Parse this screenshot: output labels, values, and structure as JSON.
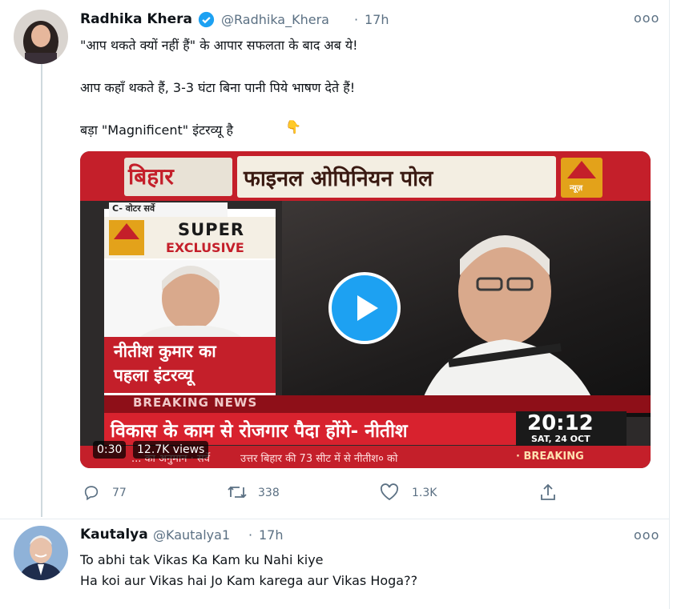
{
  "tweet": {
    "author_name": "Radhika Khera",
    "handle": "@Radhika_Khera",
    "time": "17h",
    "more": "ooo",
    "lines": [
      "\"आप थकते क्यों नहीं हैं\" के आपार सफलता के बाद अब ये!",
      "आप कहाँ थकते हैं, 3-3 घंटा बिना पानी पिये भाषण देते हैं!",
      "बड़ा \"Magnificent\" इंटरव्यू है"
    ],
    "emoji": "👇",
    "video": {
      "duration": "0:30",
      "views": "12.7K views",
      "frame_text": {
        "bihar": "बिहार",
        "title": "फाइनल ओपिनियन पोल",
        "abp_small": "न्यूज़",
        "cvoter": "C- वोटर सर्वे",
        "super": "SUPER",
        "exclusive": "EXCLUSIVE",
        "nitish_line1": "नीतीश कुमार का",
        "nitish_line2": "पहला इंटरव्यू",
        "breaking": "BREAKING NEWS",
        "headline": "विकास के काम से रोजगार पैदा होंगे- नीतीश",
        "clock": "20:12",
        "clock_date": "SAT, 24 OCT",
        "ticker_left": "... का अनुमान · सर्वे",
        "ticker_mid": "उत्तर बिहार की 73 सीट में से नीतीश० को",
        "ticker_right": "· BREAKING"
      }
    },
    "actions": {
      "reply_count": "77",
      "retweet_count": "338",
      "like_count": "1.3K"
    }
  },
  "reply": {
    "author_name": "Kautalya",
    "handle": "@Kautalya1",
    "time": "17h",
    "more": "ooo",
    "lines": [
      "To abhi tak Vikas Ka Kam ku Nahi kiye",
      "Ha koi aur Vikas hai Jo Kam karega aur Vikas Hoga??"
    ]
  },
  "colors": {
    "accent": "#1da1f2",
    "secondary_text": "#5b7083",
    "news_red": "#c41f2a"
  },
  "icons": [
    "verified-badge-icon",
    "reply-icon",
    "retweet-icon",
    "like-icon",
    "share-icon",
    "play-icon",
    "more-icon"
  ]
}
